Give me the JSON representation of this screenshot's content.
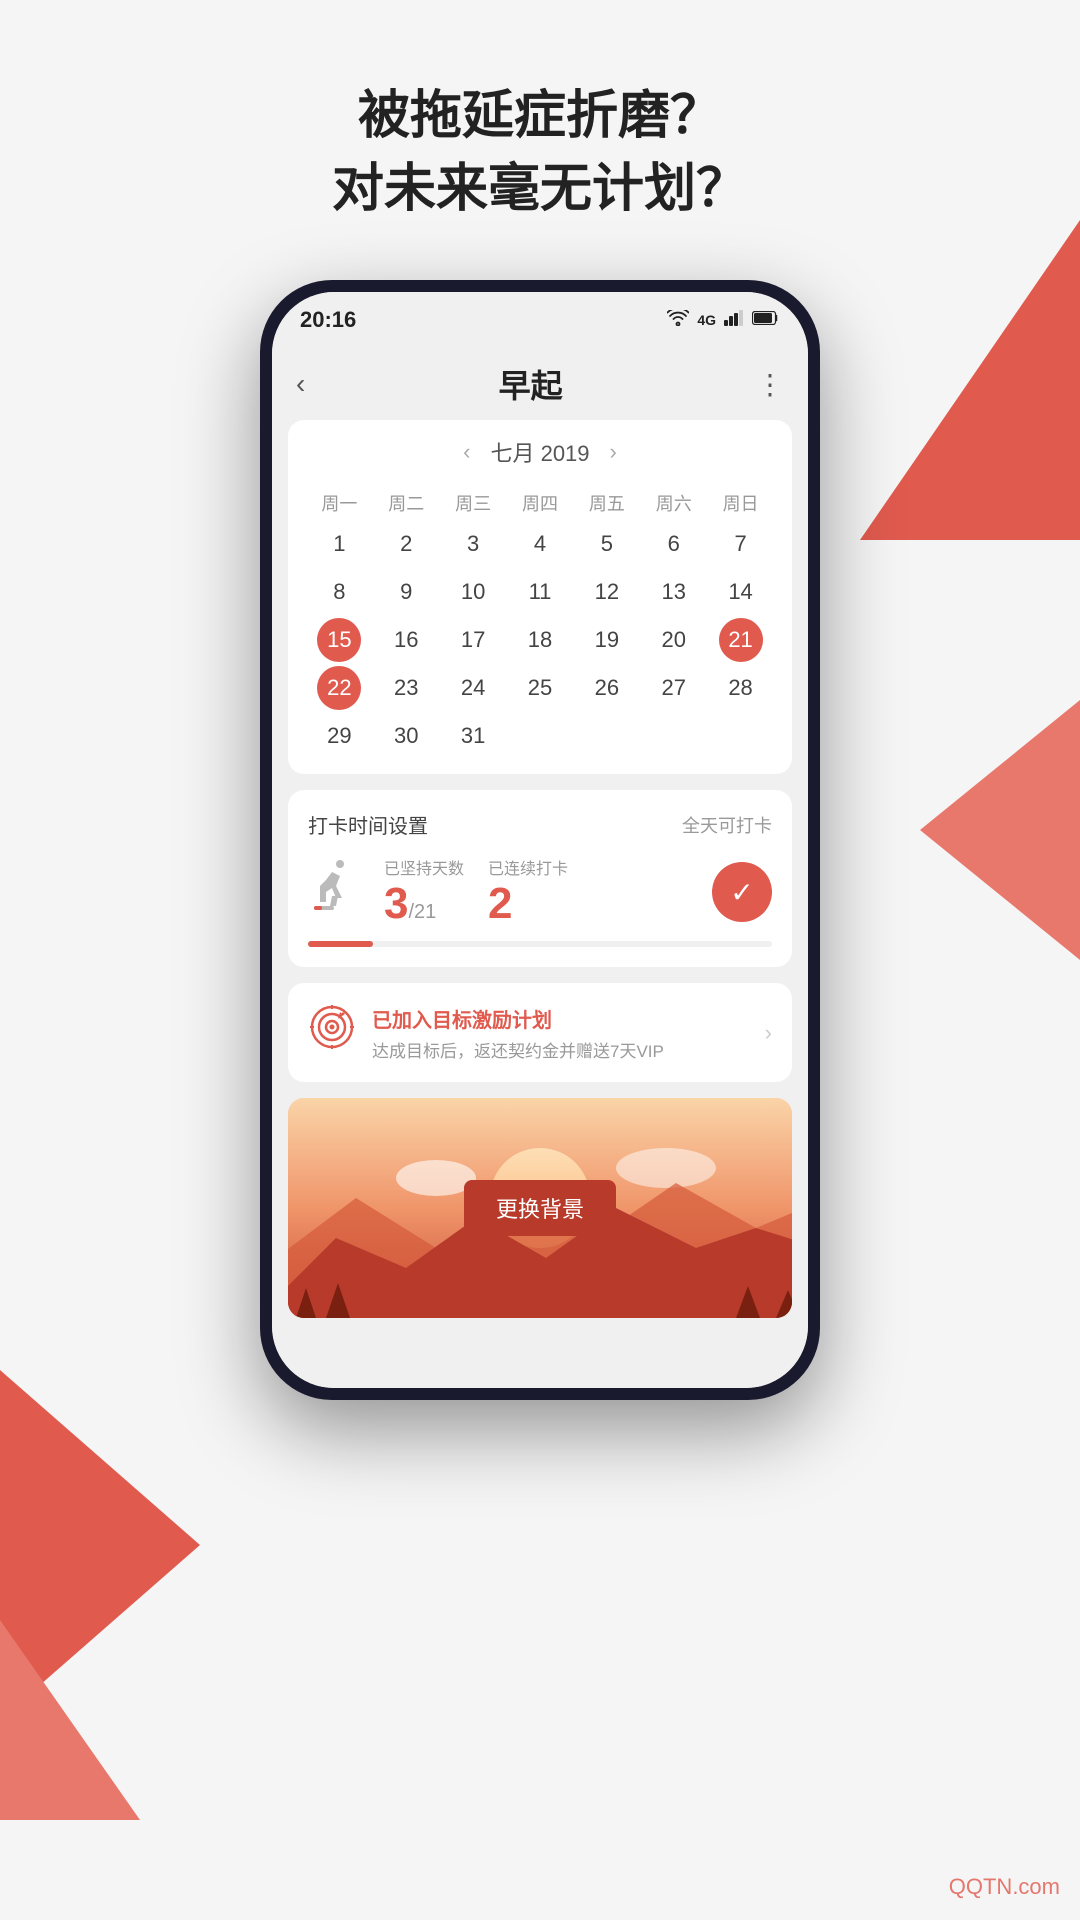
{
  "header": {
    "line1": "被拖延症折磨？",
    "line2": "对未来毫无计划？"
  },
  "statusBar": {
    "time": "20:16",
    "wifi": "WiFi",
    "signal": "4G",
    "battery": "Battery"
  },
  "topBar": {
    "back": "‹",
    "title": "早起",
    "more": "⋮"
  },
  "calendar": {
    "prevNav": "‹",
    "nextNav": "›",
    "monthYear": "七月 2019",
    "weekdays": [
      "周一",
      "周二",
      "周三",
      "周四",
      "周五",
      "周六",
      "周日"
    ],
    "days": [
      {
        "val": "1"
      },
      {
        "val": "2"
      },
      {
        "val": "3"
      },
      {
        "val": "4"
      },
      {
        "val": "5"
      },
      {
        "val": "6"
      },
      {
        "val": "7"
      },
      {
        "val": "8"
      },
      {
        "val": "9"
      },
      {
        "val": "10"
      },
      {
        "val": "11"
      },
      {
        "val": "12"
      },
      {
        "val": "13"
      },
      {
        "val": "14"
      },
      {
        "val": "15",
        "highlight": true
      },
      {
        "val": "16"
      },
      {
        "val": "17"
      },
      {
        "val": "18"
      },
      {
        "val": "19"
      },
      {
        "val": "20"
      },
      {
        "val": "21",
        "highlight": true
      },
      {
        "val": "22",
        "highlight": true
      },
      {
        "val": "23"
      },
      {
        "val": "24"
      },
      {
        "val": "25"
      },
      {
        "val": "26"
      },
      {
        "val": "27"
      },
      {
        "val": "28"
      },
      {
        "val": "29"
      },
      {
        "val": "30"
      },
      {
        "val": "31"
      }
    ]
  },
  "statsCard": {
    "headerLabel": "打卡时间设置",
    "headerRight": "全天可打卡",
    "persistedLabel": "已坚持天数",
    "persistedValue": "3",
    "persistedSub": "/21",
    "consecutiveLabel": "已连续打卡",
    "consecutiveValue": "2",
    "checkIcon": "✓"
  },
  "goalCard": {
    "title": "已加入目标激励计划",
    "subtitle": "达成目标后，返还契约金并赠送7天VIP",
    "arrow": "›"
  },
  "bgCard": {
    "btnLabel": "更换背景"
  },
  "watermark": {
    "text": "QQTN.com"
  }
}
